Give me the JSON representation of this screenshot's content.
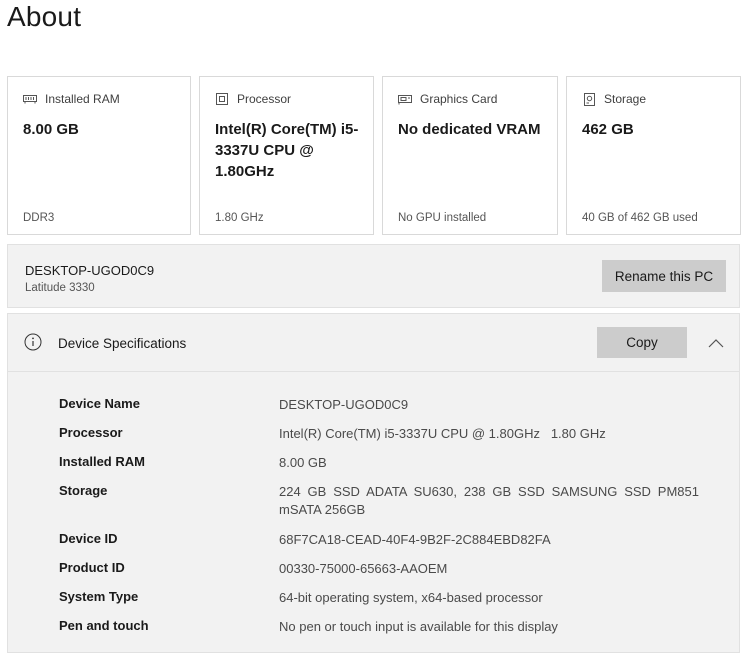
{
  "page": {
    "title": "About"
  },
  "cards": [
    {
      "icon": "memory-icon",
      "label": "Installed RAM",
      "value": "8.00 GB",
      "sub": "DDR3"
    },
    {
      "icon": "processor-icon",
      "label": "Processor",
      "value": "Intel(R) Core(TM) i5-3337U CPU @ 1.80GHz",
      "sub": "1.80 GHz"
    },
    {
      "icon": "graphics-card-icon",
      "label": "Graphics Card",
      "value": "No dedicated VRAM",
      "sub": "No GPU installed"
    },
    {
      "icon": "storage-icon",
      "label": "Storage",
      "value": "462 GB",
      "sub": "40 GB of 462 GB used"
    }
  ],
  "pc": {
    "name": "DESKTOP-UGOD0C9",
    "model": "Latitude 3330",
    "rename_label": "Rename this PC"
  },
  "specs": {
    "title": "Device Specifications",
    "copy_label": "Copy",
    "rows": [
      {
        "key": "Device Name",
        "value": "DESKTOP-UGOD0C9"
      },
      {
        "key": "Processor",
        "value": "Intel(R) Core(TM) i5-3337U CPU @ 1.80GHz   1.80 GHz"
      },
      {
        "key": "Installed RAM",
        "value": "8.00 GB"
      },
      {
        "key": "Storage",
        "value": "224 GB SSD ADATA SU630, 238 GB SSD SAMSUNG SSD PM851 mSATA 256GB"
      },
      {
        "key": "Device ID",
        "value": "68F7CA18-CEAD-40F4-9B2F-2C884EBD82FA"
      },
      {
        "key": "Product ID",
        "value": "00330-75000-65663-AAOEM"
      },
      {
        "key": "System Type",
        "value": "64-bit operating system, x64-based processor"
      },
      {
        "key": "Pen and touch",
        "value": "No pen or touch input is available for this display"
      }
    ]
  }
}
